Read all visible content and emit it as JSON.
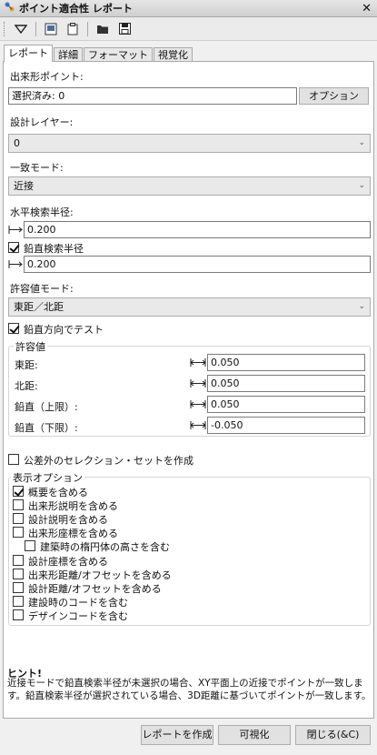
{
  "window": {
    "title": "ポイント適合性 レポート",
    "close": "✕"
  },
  "tabs": [
    "レポート",
    "詳細",
    "フォーマット",
    "視覚化"
  ],
  "asbuilt": {
    "label": "出来形ポイント:",
    "value": "選択済み: 0",
    "options_button": "オプション"
  },
  "design_layer": {
    "label": "設計レイヤー:",
    "value": "0"
  },
  "match_mode": {
    "label": "一致モード:",
    "value": "近接"
  },
  "horizontal_radius": {
    "label": "水平検索半径:",
    "value": "0.200"
  },
  "vertical_radius": {
    "label": "鉛直検索半径",
    "checked": true,
    "value": "0.200"
  },
  "tolerance_mode": {
    "label": "許容値モード:",
    "value": "東距／北距"
  },
  "vertical_test": {
    "label": "鉛直方向でテスト",
    "checked": true
  },
  "tolerance": {
    "title": "許容値",
    "rows": [
      {
        "label": "東距:",
        "value": "0.050"
      },
      {
        "label": "北距:",
        "value": "0.050"
      },
      {
        "label": "鉛直（上限）:",
        "value": "0.050"
      },
      {
        "label": "鉛直（下限）:",
        "value": "-0.050"
      }
    ]
  },
  "create_selection_set": {
    "label": "公差外のセレクション・セットを作成",
    "checked": false
  },
  "display_options": {
    "title": "表示オプション",
    "items": [
      {
        "label": "概要を含める",
        "checked": true,
        "indent": false
      },
      {
        "label": "出来形説明を含める",
        "checked": false,
        "indent": false
      },
      {
        "label": "設計説明を含める",
        "checked": false,
        "indent": false
      },
      {
        "label": "出来形座標を含める",
        "checked": false,
        "indent": false
      },
      {
        "label": "建築時の楕円体の高さを含む",
        "checked": false,
        "indent": true
      },
      {
        "label": "設計座標を含める",
        "checked": false,
        "indent": false
      },
      {
        "label": "出来形距離/オフセットを含める",
        "checked": false,
        "indent": false
      },
      {
        "label": "設計距離/オフセットを含める",
        "checked": false,
        "indent": false
      },
      {
        "label": "建設時のコードを含む",
        "checked": false,
        "indent": false
      },
      {
        "label": "デザインコードを含む",
        "checked": false,
        "indent": false
      }
    ]
  },
  "hint": {
    "title": "ヒント!",
    "text": "近接モードで鉛直検索半径が未選択の場合、XY平面上の近接でポイントが一致します。鉛直検索半径が選択されている場合、3D距離に基づいてポイントが一致します。"
  },
  "buttons": {
    "create_report": "レポートを作成",
    "visualize": "可視化",
    "close": "閉じる(&C)"
  }
}
